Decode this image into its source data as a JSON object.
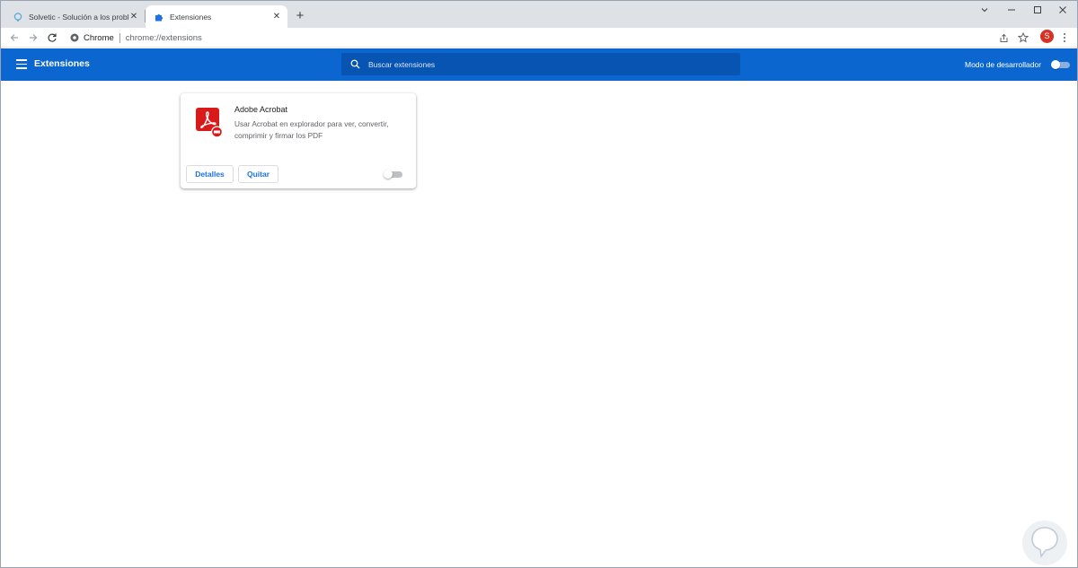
{
  "tabs": [
    {
      "title": "Solvetic - Solución a los problem",
      "icon": "solvetic-favicon",
      "active": false
    },
    {
      "title": "Extensiones",
      "icon": "puzzle-icon",
      "active": true
    }
  ],
  "toolbar": {
    "site_label": "Chrome",
    "url": "chrome://extensions",
    "avatar_letter": "S"
  },
  "header": {
    "title": "Extensiones",
    "search_placeholder": "Buscar extensiones",
    "dev_mode_label": "Modo de desarrollador",
    "dev_mode_enabled": false
  },
  "extensions": [
    {
      "name": "Adobe Acrobat",
      "description": "Usar Acrobat en explorador para ver, convertir, comprimir y firmar los PDF",
      "details_label": "Detalles",
      "remove_label": "Quitar",
      "enabled": false
    }
  ],
  "colors": {
    "header_bg": "#0b67cf",
    "search_bg": "#0754b2",
    "accent": "#1a73e8",
    "acrobat_red": "#d91a1a"
  }
}
